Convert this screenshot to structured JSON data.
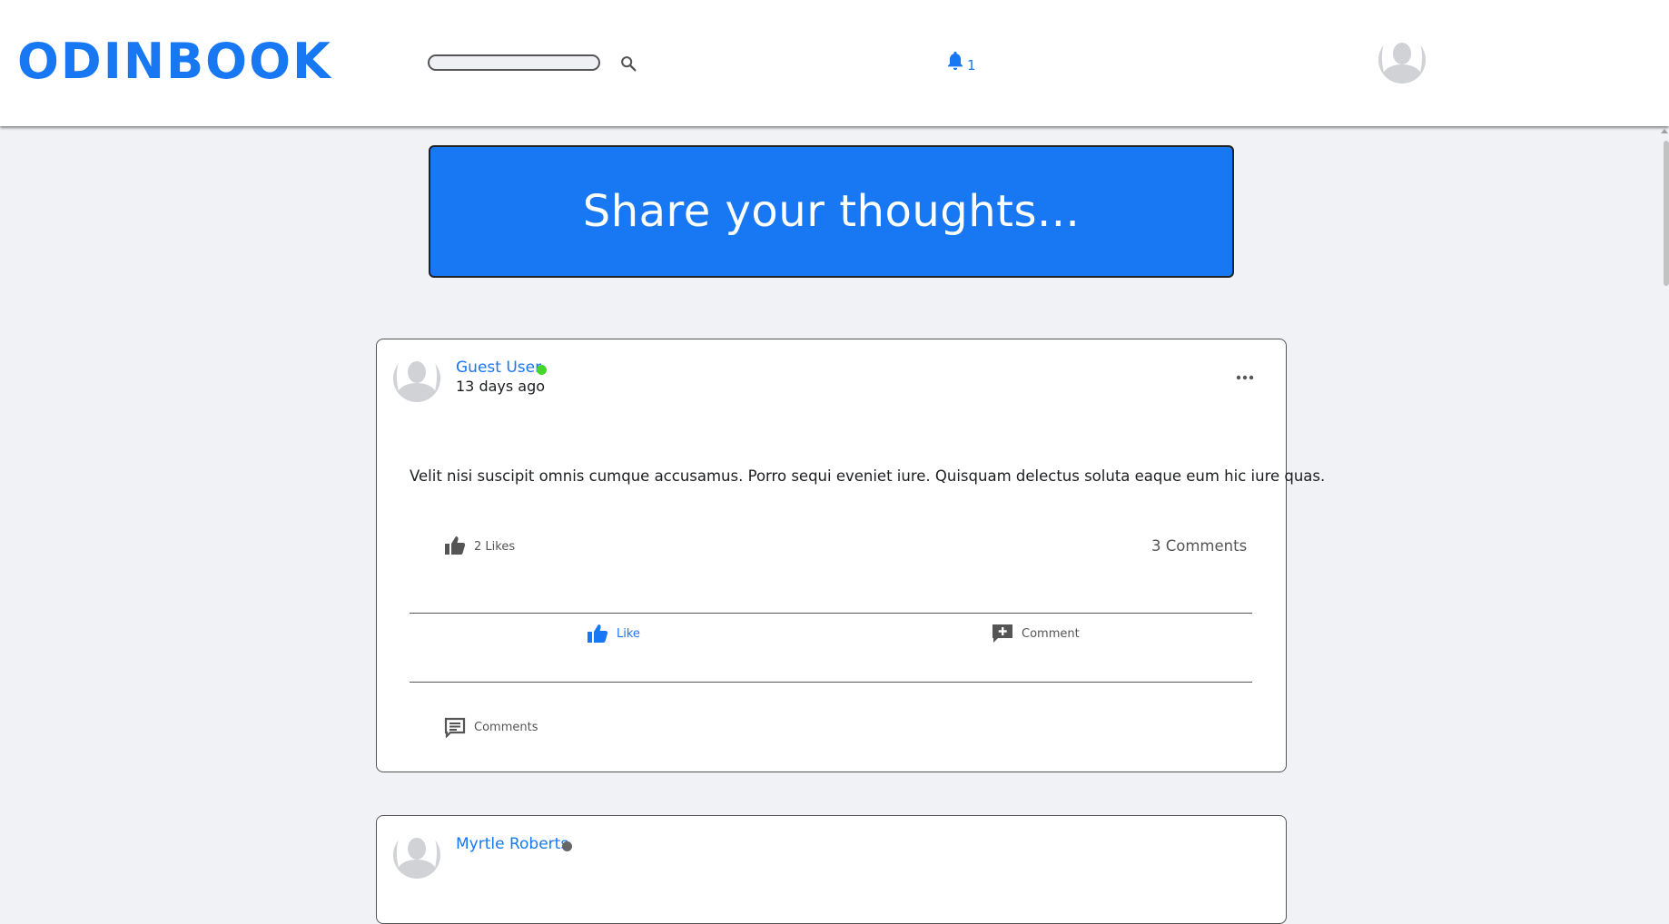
{
  "app": {
    "logo": "ODINBOOK",
    "brand_color": "#1877f2",
    "background_color": "#f0f2f5"
  },
  "header": {
    "search": {
      "value": "",
      "placeholder": "",
      "icon": "magnifier"
    },
    "notifications": {
      "icon": "bell",
      "count": "1"
    },
    "profile_icon": "avatar-silhouette"
  },
  "composer": {
    "label": "Share your thoughts..."
  },
  "posts": [
    {
      "author": "Guest User",
      "online": true,
      "status_color": "#46d62b",
      "timestamp": "13 days ago",
      "text": "Velit nisi suscipit omnis cumque accusamus. Porro sequi eveniet iure. Quisquam delectus soluta eaque eum hic iure quas.",
      "likes_label": "2 Likes",
      "comments_label": "3 Comments",
      "actions": {
        "like": "Like",
        "comment": "Comment"
      },
      "comments_toggle": "Comments"
    },
    {
      "author": "Myrtle Roberts",
      "online": false,
      "status_color": "#666666"
    }
  ]
}
